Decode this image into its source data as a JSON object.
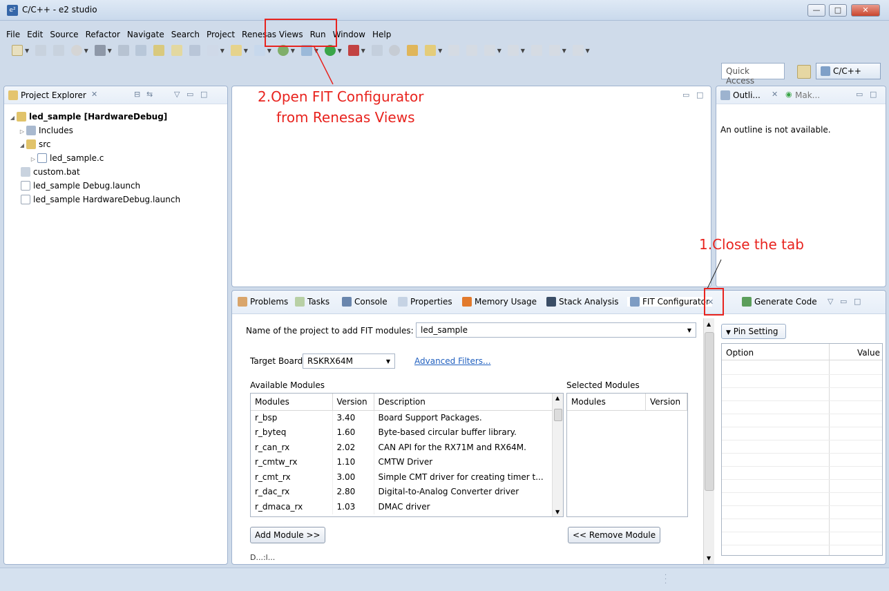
{
  "window": {
    "title": "C/C++ - e2 studio",
    "minimize": "—",
    "maximize": "□",
    "close": "✕"
  },
  "menu": [
    "File",
    "Edit",
    "Source",
    "Refactor",
    "Navigate",
    "Search",
    "Project",
    "Renesas Views",
    "Run",
    "Window",
    "Help"
  ],
  "toolbar": {
    "quick_access": "Quick Access",
    "perspective": "C/C++"
  },
  "project_explorer": {
    "title": "Project Explorer",
    "items": [
      {
        "label": "led_sample [HardwareDebug]",
        "bold": true
      },
      {
        "label": "Includes"
      },
      {
        "label": "src"
      },
      {
        "label": "led_sample.c"
      },
      {
        "label": "custom.bat"
      },
      {
        "label": "led_sample Debug.launch"
      },
      {
        "label": "led_sample HardwareDebug.launch"
      }
    ]
  },
  "outline": {
    "tab1": "Outli...",
    "tab2": "Mak...",
    "message": "An outline is not available."
  },
  "annotations": {
    "step2_line1": "2.Open FIT Configurator",
    "step2_line2": "from Renesas Views",
    "step1": "1.Close the tab"
  },
  "bottom_tabs": [
    "Problems",
    "Tasks",
    "Console",
    "Properties",
    "Memory Usage",
    "Stack Analysis",
    "FIT Configurator",
    "Generate Code"
  ],
  "fit": {
    "project_label": "Name of the project to add FIT modules:",
    "project_value": "led_sample",
    "target_label": "Target Board",
    "target_value": "RSKRX64M",
    "advanced_filters": "Advanced Filters...",
    "available_label": "Available Modules",
    "selected_label": "Selected Modules",
    "col_modules": "Modules",
    "col_version": "Version",
    "col_description": "Description",
    "modules": [
      {
        "name": "r_bsp",
        "version": "3.40",
        "description": "Board Support Packages."
      },
      {
        "name": "r_byteq",
        "version": "1.60",
        "description": "Byte-based circular buffer library."
      },
      {
        "name": "r_can_rx",
        "version": "2.02",
        "description": "CAN API for the RX71M and RX64M."
      },
      {
        "name": "r_cmtw_rx",
        "version": "1.10",
        "description": "CMTW Driver"
      },
      {
        "name": "r_cmt_rx",
        "version": "3.00",
        "description": "Simple CMT driver for creating timer t..."
      },
      {
        "name": "r_dac_rx",
        "version": "2.80",
        "description": "Digital-to-Analog Converter driver"
      },
      {
        "name": "r_dmaca_rx",
        "version": "1.03",
        "description": "DMAC driver"
      }
    ],
    "add_button": "Add Module >>",
    "remove_button": "<< Remove Module",
    "details_partial": "D...:l..."
  },
  "pin_setting": {
    "tab": "Pin Setting",
    "col_option": "Option",
    "col_value": "Value"
  }
}
